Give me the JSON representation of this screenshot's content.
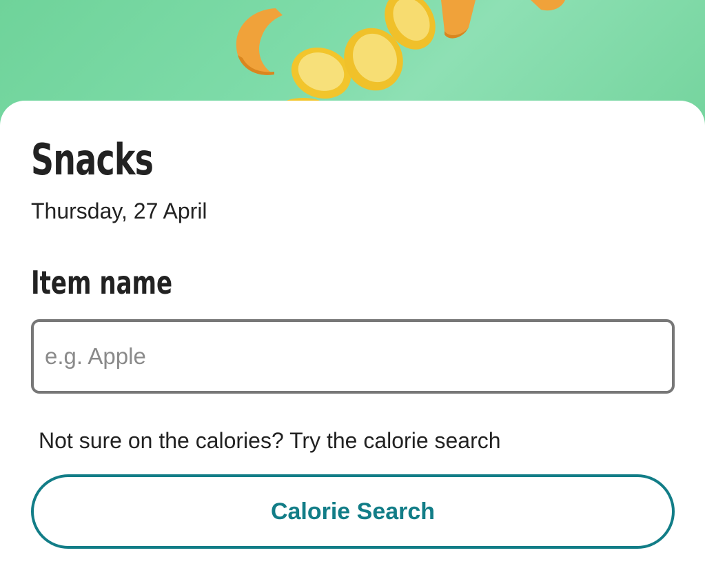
{
  "hero": {
    "image": "flying-banana-pumpkin-slices",
    "background_color": "#7cd9a8"
  },
  "page": {
    "title": "Snacks",
    "date": "Thursday, 27 April"
  },
  "form": {
    "item_name_label": "Item name",
    "item_name_value": "",
    "item_name_placeholder": "e.g. Apple"
  },
  "hint": {
    "text": "Not sure on the calories? Try the calorie search"
  },
  "actions": {
    "calorie_search_label": "Calorie Search",
    "accent_color": "#127d87"
  }
}
